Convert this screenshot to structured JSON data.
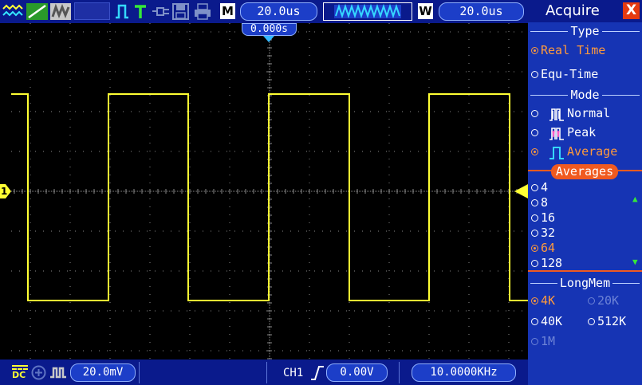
{
  "topbar": {
    "m_label": "M",
    "timebase": "20.0us",
    "w_label": "W",
    "window_timebase": "20.0us",
    "trigger_pos": "0.000s",
    "icons": [
      "display-waveform-icon",
      "draw-lines-icon",
      "persistence-icon",
      "trigger-edge-icon",
      "trigger-t-icon",
      "usb-plug-icon",
      "save-disk-icon",
      "printer-icon",
      "memory-waveform-icon"
    ]
  },
  "screen": {
    "ch1_marker": "1",
    "colors": {
      "trace": "#ffff33",
      "grid": "#8a8a8a",
      "ch1": "#ffff33"
    }
  },
  "bottombar": {
    "coupling": "DC",
    "volts_div": "20.0mV",
    "trigger_source": "CH1",
    "trigger_level": "0.00V",
    "frequency": "10.0000KHz"
  },
  "panel": {
    "title": "Acquire",
    "close": "X",
    "type_header": "Type",
    "type_options": [
      {
        "label": "Real Time",
        "selected": true
      },
      {
        "label": "Equ-Time",
        "selected": false
      }
    ],
    "mode_header": "Mode",
    "mode_options": [
      {
        "label": "Normal",
        "selected": false
      },
      {
        "label": "Peak",
        "selected": false
      },
      {
        "label": "Average",
        "selected": true
      }
    ],
    "averages_header": "Averages",
    "averages_options": [
      {
        "label": "4",
        "selected": false
      },
      {
        "label": "8",
        "selected": false
      },
      {
        "label": "16",
        "selected": false
      },
      {
        "label": "32",
        "selected": false
      },
      {
        "label": "64",
        "selected": true
      },
      {
        "label": "128",
        "selected": false
      }
    ],
    "longmem_header": "LongMem",
    "longmem_options": [
      {
        "label": "4K",
        "selected": true,
        "enabled": true
      },
      {
        "label": "20K",
        "selected": false,
        "enabled": false
      },
      {
        "label": "40K",
        "selected": false,
        "enabled": true
      },
      {
        "label": "512K",
        "selected": false,
        "enabled": true
      },
      {
        "label": "1M",
        "selected": false,
        "enabled": false
      }
    ]
  }
}
